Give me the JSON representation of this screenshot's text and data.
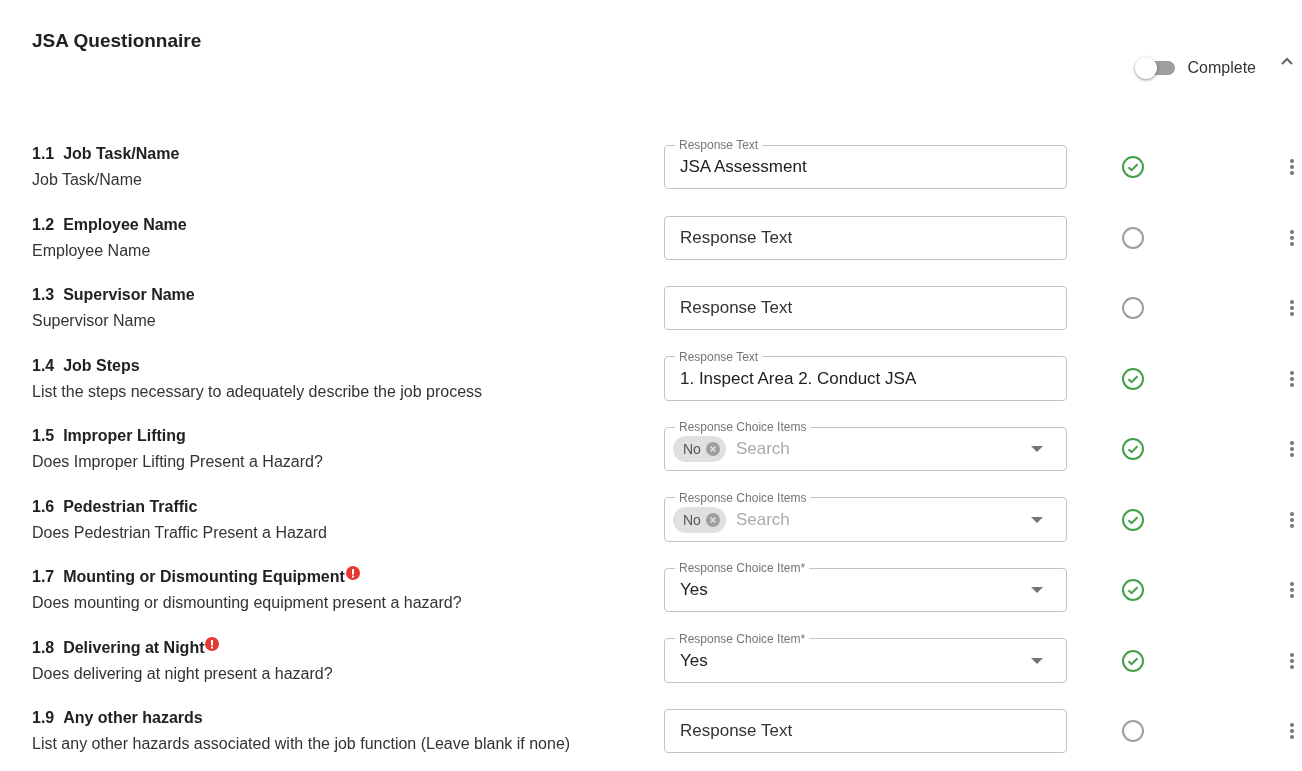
{
  "title": "JSA Questionnaire",
  "complete_toggle": {
    "label": "Complete",
    "on": false
  },
  "section": {
    "expanded": true
  },
  "questions": [
    {
      "number": "1.1",
      "title": "Job Task/Name",
      "description": "Job Task/Name",
      "required": false,
      "answered": true,
      "field": {
        "kind": "text",
        "label": "Response Text",
        "value": "JSA Assessment"
      }
    },
    {
      "number": "1.2",
      "title": "Employee Name",
      "description": "Employee Name",
      "required": false,
      "answered": false,
      "field": {
        "kind": "text",
        "placeholder": "Response Text"
      }
    },
    {
      "number": "1.3",
      "title": "Supervisor Name",
      "description": "Supervisor Name",
      "required": false,
      "answered": false,
      "field": {
        "kind": "text",
        "placeholder": "Response Text"
      }
    },
    {
      "number": "1.4",
      "title": "Job Steps",
      "description": "List the steps necessary to adequately describe the job process",
      "required": false,
      "answered": true,
      "field": {
        "kind": "text",
        "label": "Response Text",
        "value": "1. Inspect Area 2. Conduct JSA"
      }
    },
    {
      "number": "1.5",
      "title": "Improper Lifting",
      "description": "Does Improper Lifting Present a Hazard?",
      "required": false,
      "answered": true,
      "field": {
        "kind": "multi",
        "label": "Response Choice Items",
        "chips": [
          "No"
        ],
        "placeholder": "Search"
      }
    },
    {
      "number": "1.6",
      "title": "Pedestrian Traffic",
      "description": "Does Pedestrian Traffic Present a Hazard",
      "required": false,
      "answered": true,
      "field": {
        "kind": "multi",
        "label": "Response Choice Items",
        "chips": [
          "No"
        ],
        "placeholder": "Search"
      }
    },
    {
      "number": "1.7",
      "title": "Mounting or Dismounting Equipment",
      "description": "Does mounting or dismounting equipment present a hazard?",
      "required": true,
      "answered": true,
      "field": {
        "kind": "select",
        "label": "Response Choice Item*",
        "value": "Yes"
      }
    },
    {
      "number": "1.8",
      "title": "Delivering at Night",
      "description": "Does delivering at night present a hazard?",
      "required": true,
      "answered": true,
      "field": {
        "kind": "select",
        "label": "Response Choice Item*",
        "value": "Yes"
      }
    },
    {
      "number": "1.9",
      "title": "Any other hazards",
      "description": "List any other hazards associated with the job function (Leave blank if none)",
      "required": false,
      "answered": false,
      "field": {
        "kind": "text",
        "placeholder": "Response Text"
      }
    }
  ]
}
